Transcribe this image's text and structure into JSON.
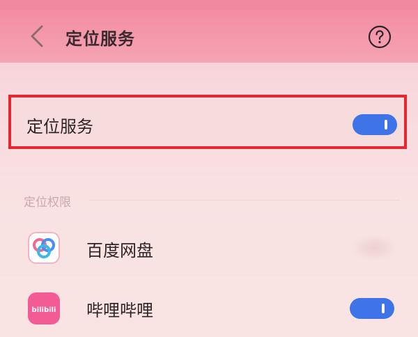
{
  "header": {
    "title": "定位服务",
    "back_icon": "chevron-left-icon",
    "help_icon": "help-circle-icon"
  },
  "location_service": {
    "label": "定位服务",
    "enabled": true,
    "highlight_color": "#e8262f"
  },
  "permissions_section": {
    "label": "定位权限"
  },
  "apps": [
    {
      "name": "百度网盘",
      "icon": "baidu-netdisk-icon"
    },
    {
      "name": "哔哩哔哩",
      "icon": "bilibili-icon",
      "icon_text": "bilibili",
      "enabled": true
    }
  ],
  "colors": {
    "toggle_on": "#3f73e8",
    "header_bg": "#f38da3"
  }
}
